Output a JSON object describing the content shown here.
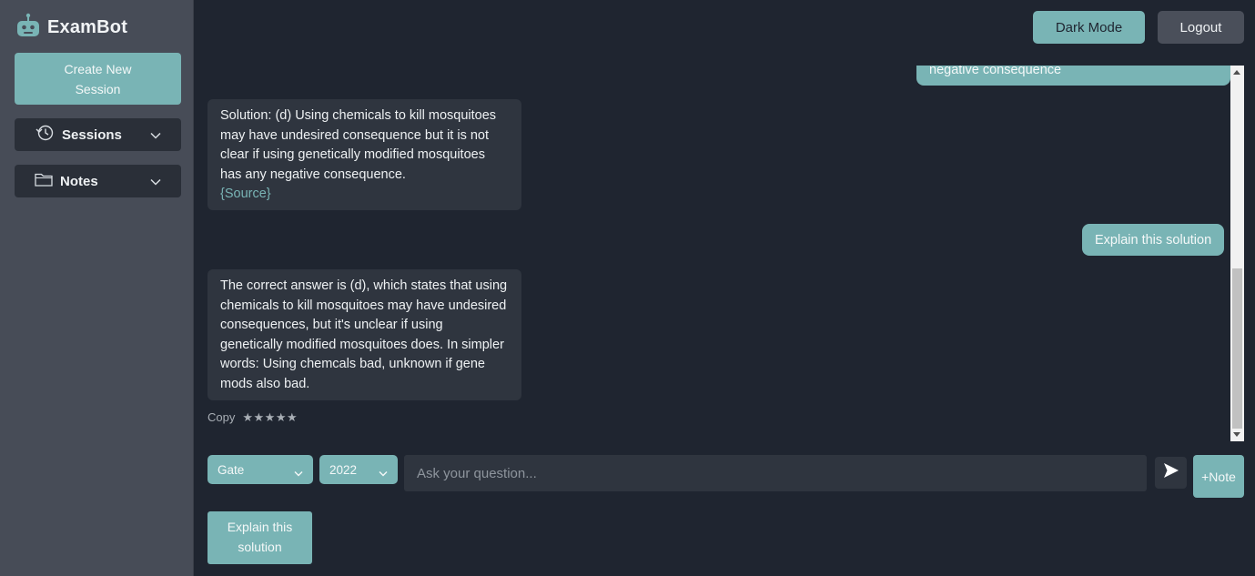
{
  "app": {
    "name": "ExamBot"
  },
  "sidebar": {
    "create_label": "Create New\nSession",
    "sessions_label": "Sessions",
    "notes_label": "Notes"
  },
  "header": {
    "dark_mode_label": "Dark Mode",
    "logout_label": "Logout"
  },
  "chat": {
    "partial_user_msg": "negative consequence",
    "bot_msg_1": "Solution: (d) Using chemicals to kill mosquitoes may have undesired consequence but it is not clear if using genetically modified mosquitoes has any negative consequence.",
    "bot_msg_1_source": "{Source}",
    "user_msg_2": "Explain this solution",
    "bot_msg_2": "The correct answer is (d), which states that using chemicals to kill mosquitoes may have undesired consequences, but it's unclear if using genetically modified mosquitoes does. In simpler words: Using chemcals bad, unknown if gene mods also bad.",
    "copy_label": "Copy",
    "stars": "★★★★★"
  },
  "composer": {
    "exam_select": "Gate",
    "year_select": "2022",
    "placeholder": "Ask your question...",
    "note_label": "+Note",
    "suggestion_label": "Explain this solution"
  },
  "colors": {
    "accent": "#79b4b5",
    "background": "#1f2530",
    "sidebar": "#474c57",
    "bubble": "#2f353f"
  }
}
